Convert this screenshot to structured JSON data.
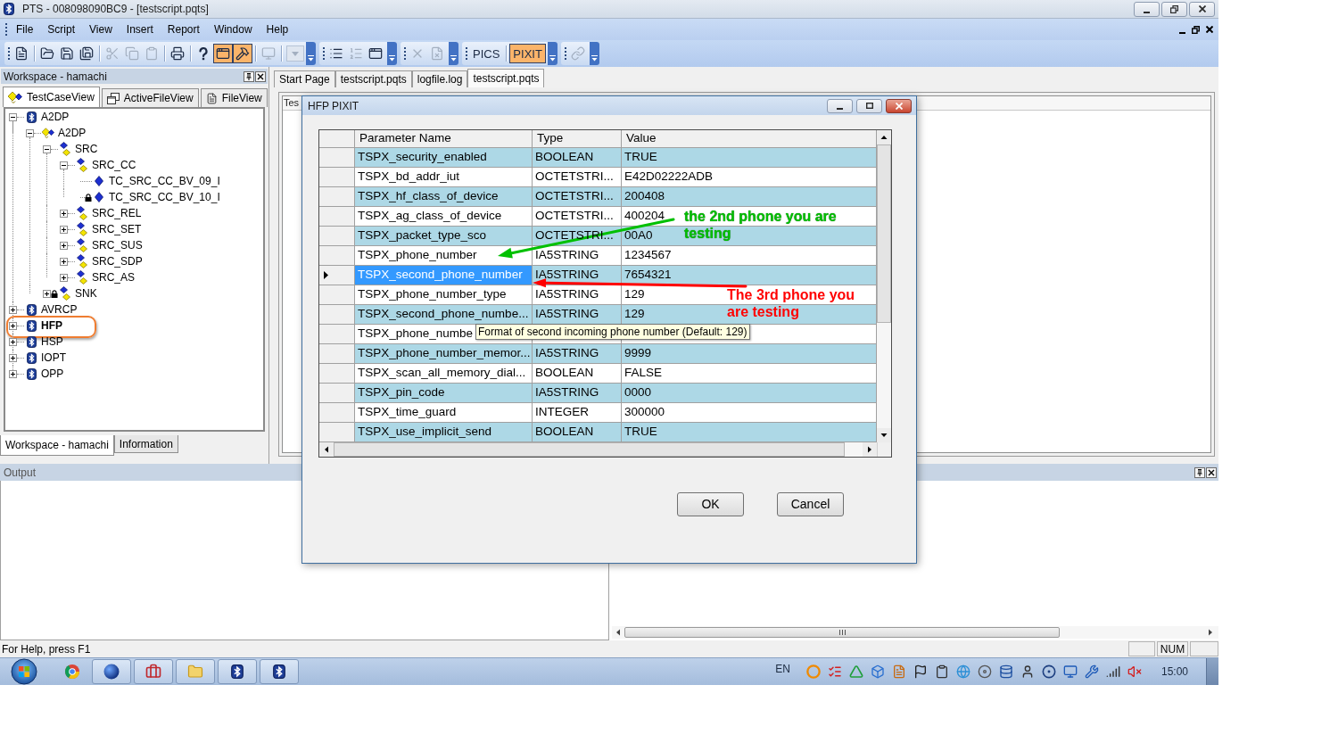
{
  "window": {
    "title": "PTS - 008098090BC9 - [testscript.pqts]"
  },
  "menu": [
    "File",
    "Script",
    "View",
    "Insert",
    "Report",
    "Window",
    "Help"
  ],
  "toolbar": {
    "groups": [
      {
        "items": [
          {
            "kind": "icon",
            "pressed": false,
            "disabled": false
          },
          {
            "kind": "separator"
          },
          {
            "kind": "icon",
            "pressed": false,
            "disabled": false
          },
          {
            "kind": "icon",
            "pressed": false,
            "disabled": false
          },
          {
            "kind": "icon",
            "pressed": false,
            "disabled": false
          },
          {
            "kind": "separator"
          },
          {
            "kind": "icon",
            "pressed": false,
            "disabled": true
          },
          {
            "kind": "icon",
            "pressed": false,
            "disabled": true
          },
          {
            "kind": "icon",
            "pressed": false,
            "disabled": true
          },
          {
            "kind": "separator"
          },
          {
            "kind": "icon",
            "pressed": false,
            "disabled": false
          },
          {
            "kind": "separator"
          },
          {
            "kind": "icon",
            "pressed": false,
            "disabled": false
          },
          {
            "kind": "icon",
            "pressed": true,
            "disabled": false
          },
          {
            "kind": "icon",
            "pressed": true,
            "disabled": false
          },
          {
            "kind": "separator"
          },
          {
            "kind": "icon",
            "pressed": false,
            "disabled": true
          },
          {
            "kind": "separator"
          },
          {
            "kind": "dropdown",
            "disabled": true
          }
        ]
      },
      {
        "items": [
          {
            "kind": "icon",
            "pressed": false,
            "disabled": false
          },
          {
            "kind": "icon",
            "pressed": false,
            "disabled": true
          },
          {
            "kind": "icon",
            "pressed": false,
            "disabled": false
          }
        ]
      },
      {
        "items": [
          {
            "kind": "icon",
            "pressed": false,
            "disabled": true
          },
          {
            "kind": "icon",
            "pressed": false,
            "disabled": true
          }
        ]
      },
      {
        "items": [
          {
            "kind": "text",
            "label": "PICS",
            "pressed": false,
            "disabled": false
          },
          {
            "kind": "separator"
          },
          {
            "kind": "text",
            "label": "PIXIT",
            "pressed": true,
            "disabled": false
          }
        ]
      },
      {
        "items": [
          {
            "kind": "icon",
            "pressed": false,
            "disabled": true
          }
        ]
      }
    ]
  },
  "workspace": {
    "title": "Workspace - hamachi",
    "tabs": [
      {
        "label": "TestCaseView",
        "selected": true
      },
      {
        "label": "ActiveFileView",
        "selected": false
      },
      {
        "label": "FileView",
        "selected": false
      }
    ],
    "tree": [
      {
        "label": "A2DP",
        "kind": "profile",
        "expanded": true,
        "locked": false,
        "bold": false,
        "circled": false,
        "children": [
          {
            "label": "A2DP",
            "kind": "suite",
            "expanded": true,
            "locked": false,
            "bold": false,
            "circled": false,
            "children": [
              {
                "label": "SRC",
                "kind": "group",
                "expanded": true,
                "locked": false,
                "bold": false,
                "circled": false,
                "children": [
                  {
                    "label": "SRC_CC",
                    "kind": "group",
                    "expanded": true,
                    "locked": false,
                    "bold": false,
                    "circled": false,
                    "children": [
                      {
                        "label": "TC_SRC_CC_BV_09_I",
                        "kind": "testcase",
                        "locked": false,
                        "bold": false,
                        "circled": false
                      },
                      {
                        "label": "TC_SRC_CC_BV_10_I",
                        "kind": "testcase",
                        "locked": true,
                        "bold": false,
                        "circled": false
                      }
                    ]
                  },
                  {
                    "label": "SRC_REL",
                    "kind": "group",
                    "expanded": false,
                    "locked": false,
                    "bold": false,
                    "circled": false
                  },
                  {
                    "label": "SRC_SET",
                    "kind": "group",
                    "expanded": false,
                    "locked": false,
                    "bold": false,
                    "circled": false
                  },
                  {
                    "label": "SRC_SUS",
                    "kind": "group",
                    "expanded": false,
                    "locked": false,
                    "bold": false,
                    "circled": false
                  },
                  {
                    "label": "SRC_SDP",
                    "kind": "group",
                    "expanded": false,
                    "locked": false,
                    "bold": false,
                    "circled": false
                  },
                  {
                    "label": "SRC_AS",
                    "kind": "group",
                    "expanded": false,
                    "locked": false,
                    "bold": false,
                    "circled": false
                  }
                ]
              },
              {
                "label": "SNK",
                "kind": "group",
                "expanded": false,
                "locked": true,
                "bold": false,
                "circled": false
              }
            ]
          }
        ]
      },
      {
        "label": "AVRCP",
        "kind": "profile",
        "expanded": false,
        "locked": false,
        "bold": false,
        "circled": false
      },
      {
        "label": "HFP",
        "kind": "profile",
        "expanded": false,
        "locked": false,
        "bold": true,
        "circled": true
      },
      {
        "label": "HSP",
        "kind": "profile",
        "expanded": false,
        "locked": false,
        "bold": false,
        "circled": false
      },
      {
        "label": "IOPT",
        "kind": "profile",
        "expanded": false,
        "locked": false,
        "bold": false,
        "circled": false
      },
      {
        "label": "OPP",
        "kind": "profile",
        "expanded": false,
        "locked": false,
        "bold": false,
        "circled": false
      }
    ],
    "bottom_tabs": [
      {
        "label": "Workspace - hamachi",
        "selected": true
      },
      {
        "label": "Information",
        "selected": false
      }
    ]
  },
  "documents": {
    "tabs": [
      {
        "label": "Start Page",
        "selected": false
      },
      {
        "label": "testscript.pqts",
        "selected": false
      },
      {
        "label": "logfile.log",
        "selected": false
      },
      {
        "label": "testscript.pqts",
        "selected": true
      }
    ],
    "header": "Tes"
  },
  "dialog": {
    "title": "HFP PIXIT",
    "table": {
      "columns": [
        "Parameter Name",
        "Type",
        "Value"
      ],
      "rows": [
        {
          "name": "TSPX_security_enabled",
          "type": "BOOLEAN",
          "value": "TRUE",
          "selected": false
        },
        {
          "name": "TSPX_bd_addr_iut",
          "type": "OCTETSTRI...",
          "value": "E42D02222ADB",
          "selected": false
        },
        {
          "name": "TSPX_hf_class_of_device",
          "type": "OCTETSTRI...",
          "value": "200408",
          "selected": false
        },
        {
          "name": "TSPX_ag_class_of_device",
          "type": "OCTETSTRI...",
          "value": "400204",
          "selected": false
        },
        {
          "name": "TSPX_packet_type_sco",
          "type": "OCTETSTRI...",
          "value": "00A0",
          "selected": false
        },
        {
          "name": "TSPX_phone_number",
          "type": "IA5STRING",
          "value": "1234567",
          "selected": false
        },
        {
          "name": "TSPX_second_phone_number",
          "type": "IA5STRING",
          "value": "7654321",
          "selected": true
        },
        {
          "name": "TSPX_phone_number_type",
          "type": "IA5STRING",
          "value": "129",
          "selected": false
        },
        {
          "name": "TSPX_second_phone_numbe...",
          "type": "IA5STRING",
          "value": "129",
          "selected": false
        },
        {
          "name": "TSPX_phone_numbe",
          "selected": false
        },
        {
          "name": "TSPX_phone_number_memor...",
          "type": "IA5STRING",
          "value": "9999",
          "selected": false
        },
        {
          "name": "TSPX_scan_all_memory_dial...",
          "type": "BOOLEAN",
          "value": "FALSE",
          "selected": false
        },
        {
          "name": "TSPX_pin_code",
          "type": "IA5STRING",
          "value": "0000",
          "selected": false
        },
        {
          "name": "TSPX_time_guard",
          "type": "INTEGER",
          "value": "300000",
          "selected": false
        },
        {
          "name": "TSPX_use_implicit_send",
          "type": "BOOLEAN",
          "value": "TRUE",
          "selected": false
        }
      ]
    },
    "tooltip": "Format of second incoming phone number (Default: 129)",
    "buttons": [
      "OK",
      "Cancel"
    ]
  },
  "annotations": [
    {
      "text": "the 2nd phone you are testing",
      "color": "#00c000"
    },
    {
      "text": "The 3rd phone you are testing",
      "color": "#ff0000"
    }
  ],
  "output": {
    "title": "Output"
  },
  "status_bar": {
    "text": "For Help, press F1",
    "panes": [
      "NUM"
    ]
  },
  "taskbar": {
    "language": "EN",
    "clock": "15:00"
  }
}
